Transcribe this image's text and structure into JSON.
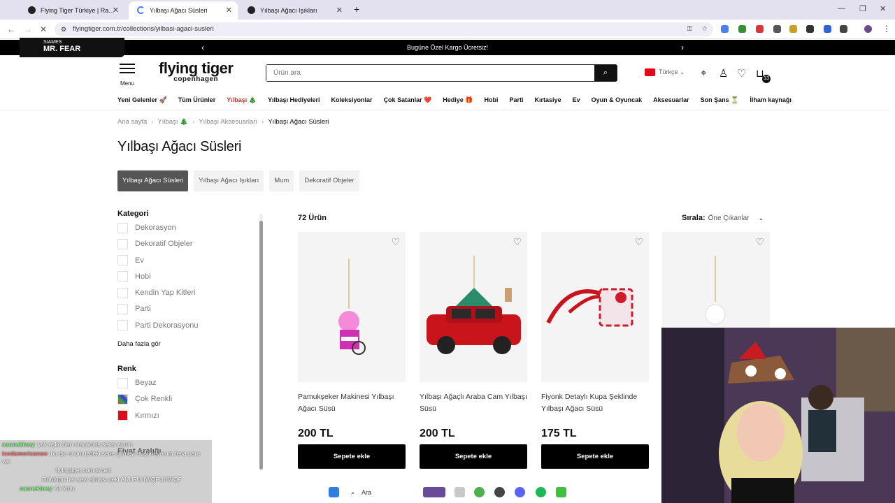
{
  "browser": {
    "tabs": [
      {
        "title": "Flying Tiger Türkiye | Ra..."
      },
      {
        "title": "Yılbaşı Ağacı Süsleri"
      },
      {
        "title": "Yılbaşı Ağacı Işıkları"
      }
    ],
    "url": "flyingtiger.com.tr/collections/yilbasi-agaci-susleri"
  },
  "stream_overlay": {
    "line1": "SIAMES",
    "line2": "MR. FEAR"
  },
  "announcement": "Bugüne Özel Kargo Ücretsiz!",
  "header": {
    "menu_label": "Menu",
    "logo_top": "flying tiger",
    "logo_bottom": "copenhagen",
    "search_placeholder": "Ürün ara",
    "language": "Türkçe",
    "cart_count": "13"
  },
  "nav": [
    "Yeni Gelenler 🚀",
    "Tüm Ürünler",
    "Yılbaşı 🎄",
    "Yılbaşı Hediyeleri",
    "Koleksiyonlar",
    "Çok Satanlar ❤️",
    "Hediye 🎁",
    "Hobi",
    "Parti",
    "Kırtasiye",
    "Ev",
    "Oyun & Oyuncak",
    "Aksesuarlar",
    "Son Şans ⏳",
    "İlham kaynağı"
  ],
  "breadcrumb": {
    "home": "Ana sayfa",
    "level1": "Yılbaşı 🎄",
    "level2": "Yılbaşı Aksesuarları",
    "current": "Yılbaşı Ağacı Süsleri"
  },
  "page_title": "Yılbaşı Ağacı Süsleri",
  "chips": [
    "Yılbaşı Ağacı Süsleri",
    "Yılbaşı Ağacı Işıkları",
    "Mum",
    "Dekoratif Objeler"
  ],
  "filters": {
    "category_heading": "Kategori",
    "categories": [
      "Dekorasyon",
      "Dekoratif Objeler",
      "Ev",
      "Hobi",
      "Kendin Yap Kitleri",
      "Parti",
      "Parti Dekorasyonu"
    ],
    "more": "Daha fazla gör",
    "color_heading": "Renk",
    "colors": [
      "Beyaz",
      "Çok Renkli",
      "Kırmızı"
    ],
    "price_heading": "Fiyat Aralığı"
  },
  "results": {
    "count": "72 Ürün",
    "sort_label": "Sırala:",
    "sort_value": "Öne Çıkanlar"
  },
  "products": [
    {
      "name": "Pamukşeker Makinesi Yılbaşı Ağacı Süsü",
      "price": "200 TL",
      "cta": "Sepete ekle"
    },
    {
      "name": "Yılbaşı Ağaçlı Araba Cam Yılbaşı Süsü",
      "price": "200 TL",
      "cta": "Sepete ekle"
    },
    {
      "name": "Fiyonk Detaylı Kupa Şeklinde Yılbaşı Ağacı Süsü",
      "price": "175 TL",
      "cta": "Sepete ekle"
    }
  ],
  "chat": [
    {
      "user": "aaonekiney",
      "msg": ": yok aşko ben macarons serisi aldım"
    },
    {
      "user": "icedamericanoo",
      "msg": ": bu işe onumuzdeki sene girmeyi düşünuyorum fena para var"
    },
    {
      "user": "",
      "msg": "flyingtiger.com.tr/cart"
    },
    {
      "user": "",
      "msg": "Gördüğü her şeyi alması peki AUHFUHWQFUHWQF"
    },
    {
      "user": "aaonekiney",
      "msg": ": 6lı kutu"
    }
  ],
  "taskbar": {
    "search": "Ara"
  },
  "colors": {
    "accent": "#000000",
    "chip_active": "#555555",
    "announcement_bg": "#000000"
  }
}
